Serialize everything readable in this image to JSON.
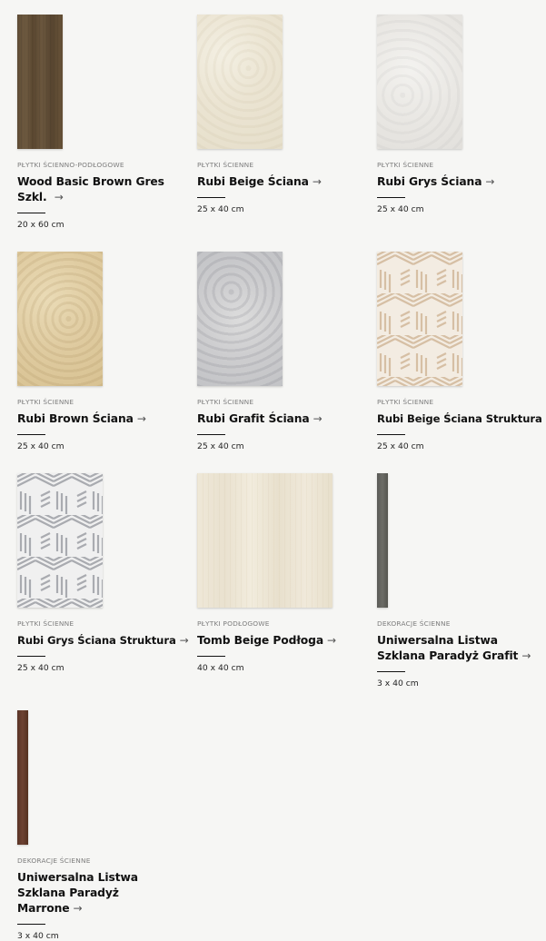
{
  "products": [
    {
      "category": "PŁYTKI ŚCIENNO-PODŁOGOWE",
      "title": "Wood Basic Brown Gres Szkl.",
      "size": "20 x 60 cm",
      "arrow": "→",
      "texture": "wood",
      "thumb_color": "#62503a"
    },
    {
      "category": "PŁYTKI ŚCIENNE",
      "title": "Rubi Beige Ściana",
      "size": "25 x 40 cm",
      "arrow": "→",
      "texture": "beige",
      "thumb_color": "#ebe4d2"
    },
    {
      "category": "PŁYTKI ŚCIENNE",
      "title": "Rubi Grys Ściana",
      "size": "25 x 40 cm",
      "arrow": "→",
      "texture": "grys",
      "thumb_color": "#e9e7e3"
    },
    {
      "category": "PŁYTKI ŚCIENNE",
      "title": "Rubi Brown Ściana",
      "size": "25 x 40 cm",
      "arrow": "→",
      "texture": "brown",
      "thumb_color": "#dfcba0"
    },
    {
      "category": "PŁYTKI ŚCIENNE",
      "title": "Rubi Grafit Ściana",
      "size": "25 x 40 cm",
      "arrow": "→",
      "texture": "grafit",
      "thumb_color": "#cdcdcf"
    },
    {
      "category": "PŁYTKI ŚCIENNE",
      "title": "Rubi Beige Ściana Struktura",
      "size": "25 x 40 cm",
      "arrow": "→",
      "texture": "hex-beige",
      "thumb_color": "#d9c4a8"
    },
    {
      "category": "PŁYTKI ŚCIENNE",
      "title": "Rubi Grys Ściana Struktura",
      "size": "25 x 40 cm",
      "arrow": "→",
      "texture": "hex-grys",
      "thumb_color": "#b9babd"
    },
    {
      "category": "PŁYTKI PODŁOGOWE",
      "title": "Tomb Beige Podłoga",
      "size": "40 x 40 cm",
      "arrow": "→",
      "texture": "tomb",
      "thumb_color": "#ece5d4"
    },
    {
      "category": "DEKORACJE ŚCIENNE",
      "title": "Uniwersalna Listwa Szklana Paradyż Grafit",
      "size": "3 x 40 cm",
      "arrow": "→",
      "texture": "listwa-grafit",
      "thumb_color": "#62625c"
    },
    {
      "category": "DEKORACJE ŚCIENNE",
      "title": "Uniwersalna Listwa Szklana Paradyż Marrone",
      "size": "3 x 40 cm",
      "arrow": "→",
      "texture": "listwa-marrone",
      "thumb_color": "#633b2c"
    }
  ]
}
